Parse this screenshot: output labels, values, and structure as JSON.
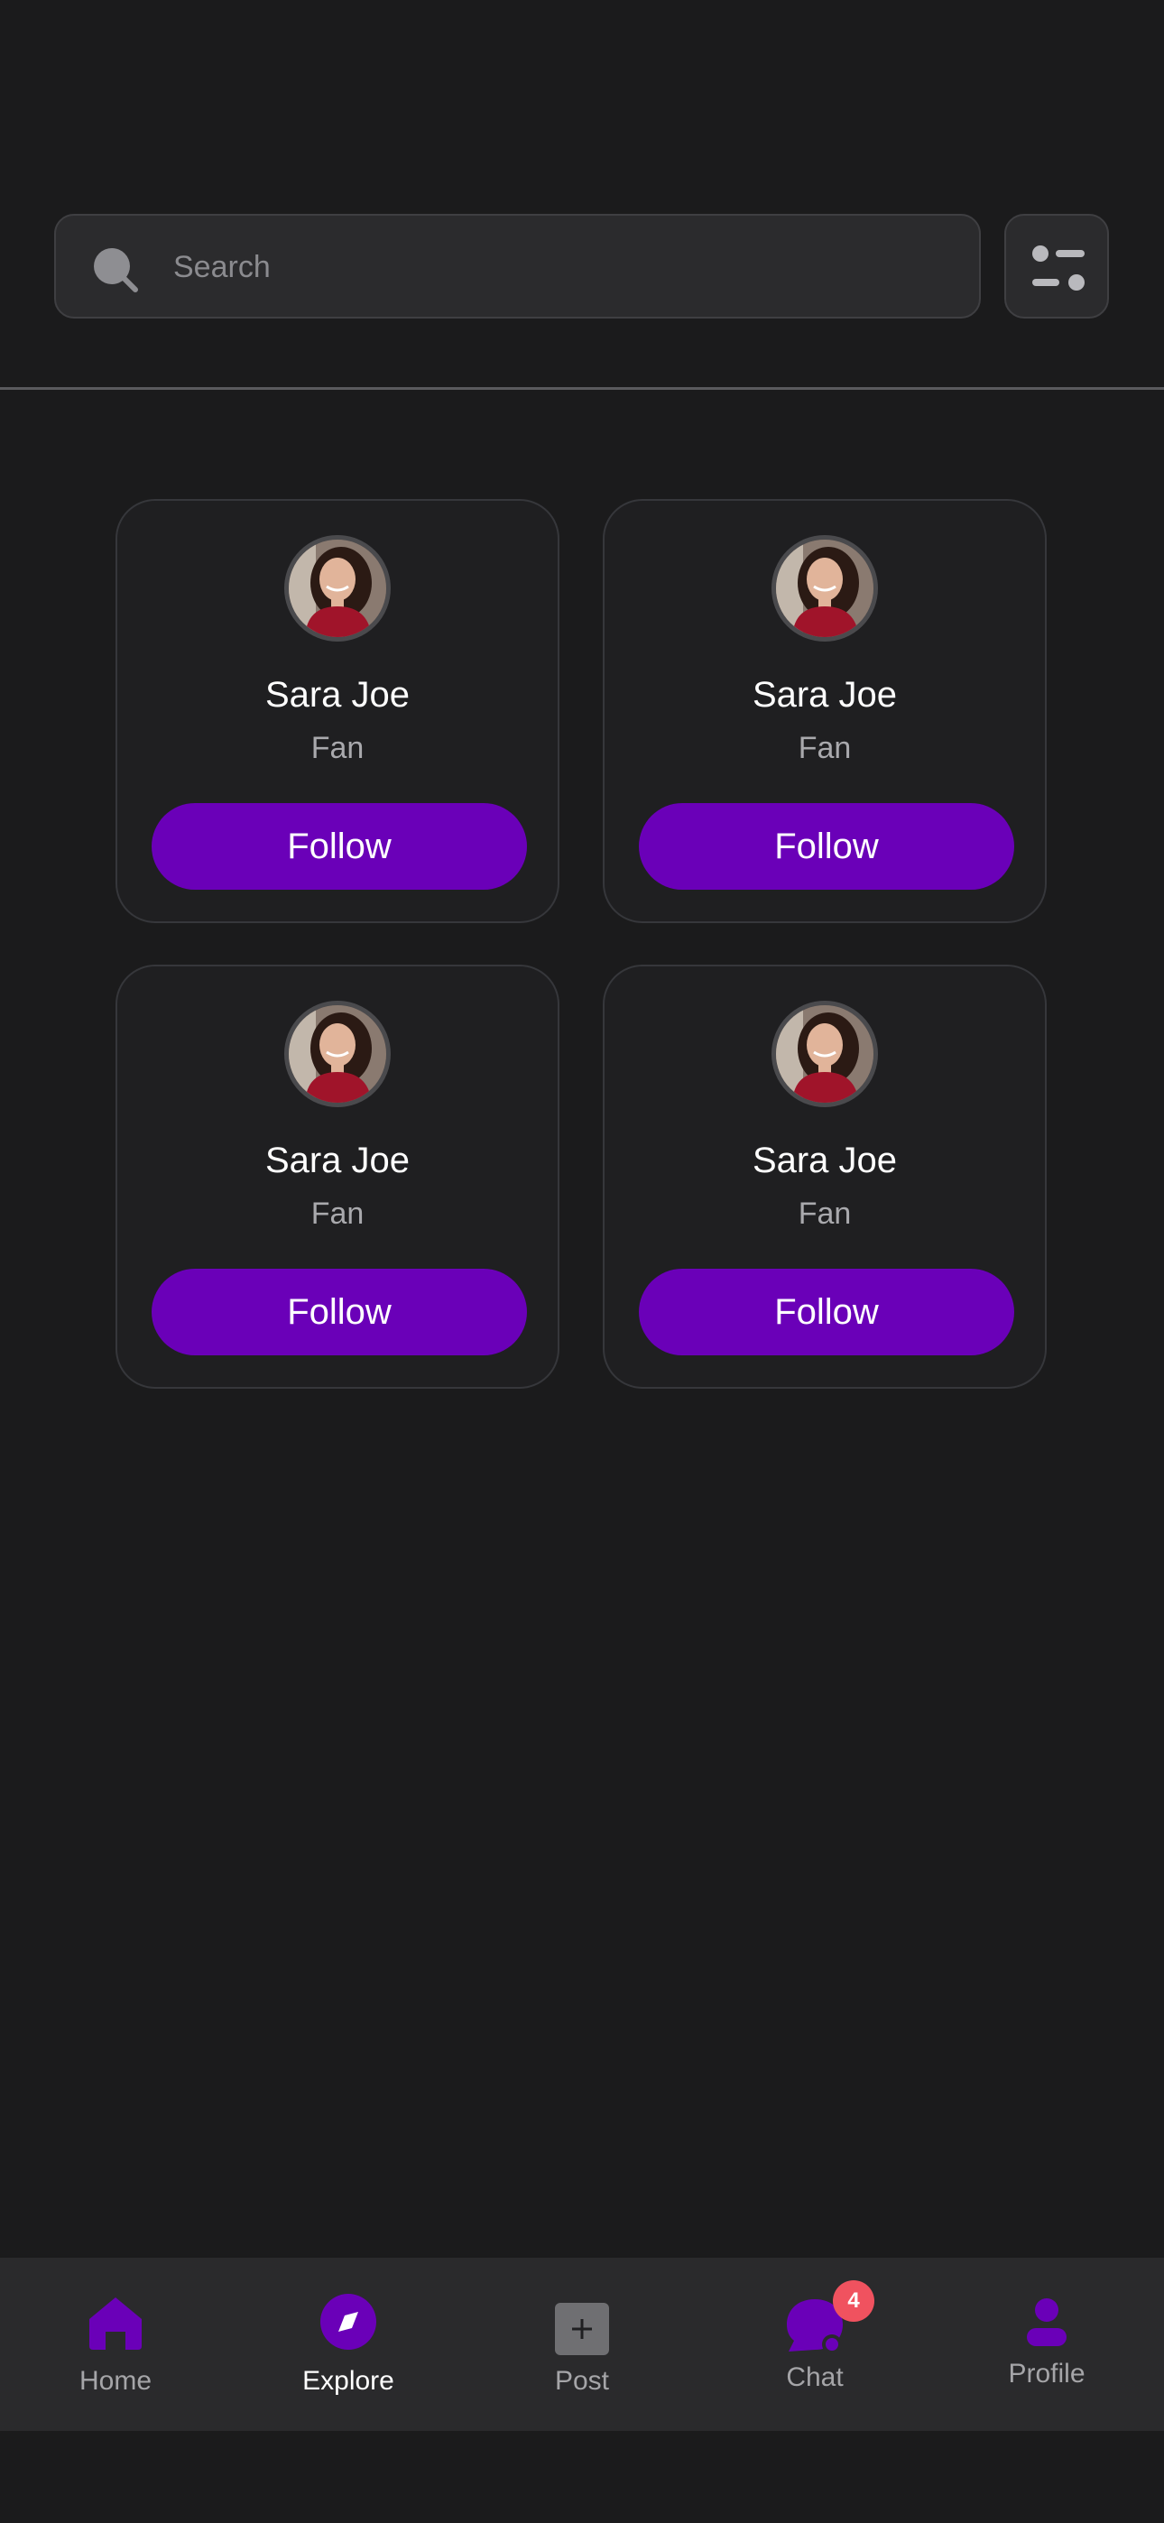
{
  "search": {
    "placeholder": "Search"
  },
  "cards": [
    {
      "name": "Sara Joe",
      "role": "Fan",
      "button": "Follow"
    },
    {
      "name": "Sara Joe",
      "role": "Fan",
      "button": "Follow"
    },
    {
      "name": "Sara Joe",
      "role": "Fan",
      "button": "Follow"
    },
    {
      "name": "Sara Joe",
      "role": "Fan",
      "button": "Follow"
    }
  ],
  "nav": {
    "items": [
      {
        "label": "Home",
        "icon": "home-icon",
        "active": false
      },
      {
        "label": "Explore",
        "icon": "compass-icon",
        "active": true
      },
      {
        "label": "Post",
        "icon": "plus-icon",
        "active": false
      },
      {
        "label": "Chat",
        "icon": "chat-icon",
        "active": false,
        "badge": "4"
      },
      {
        "label": "Profile",
        "icon": "user-icon",
        "active": false
      }
    ]
  },
  "colors": {
    "accent": "#6a00b8",
    "background": "#1b1b1c",
    "badge": "#f0525f"
  }
}
